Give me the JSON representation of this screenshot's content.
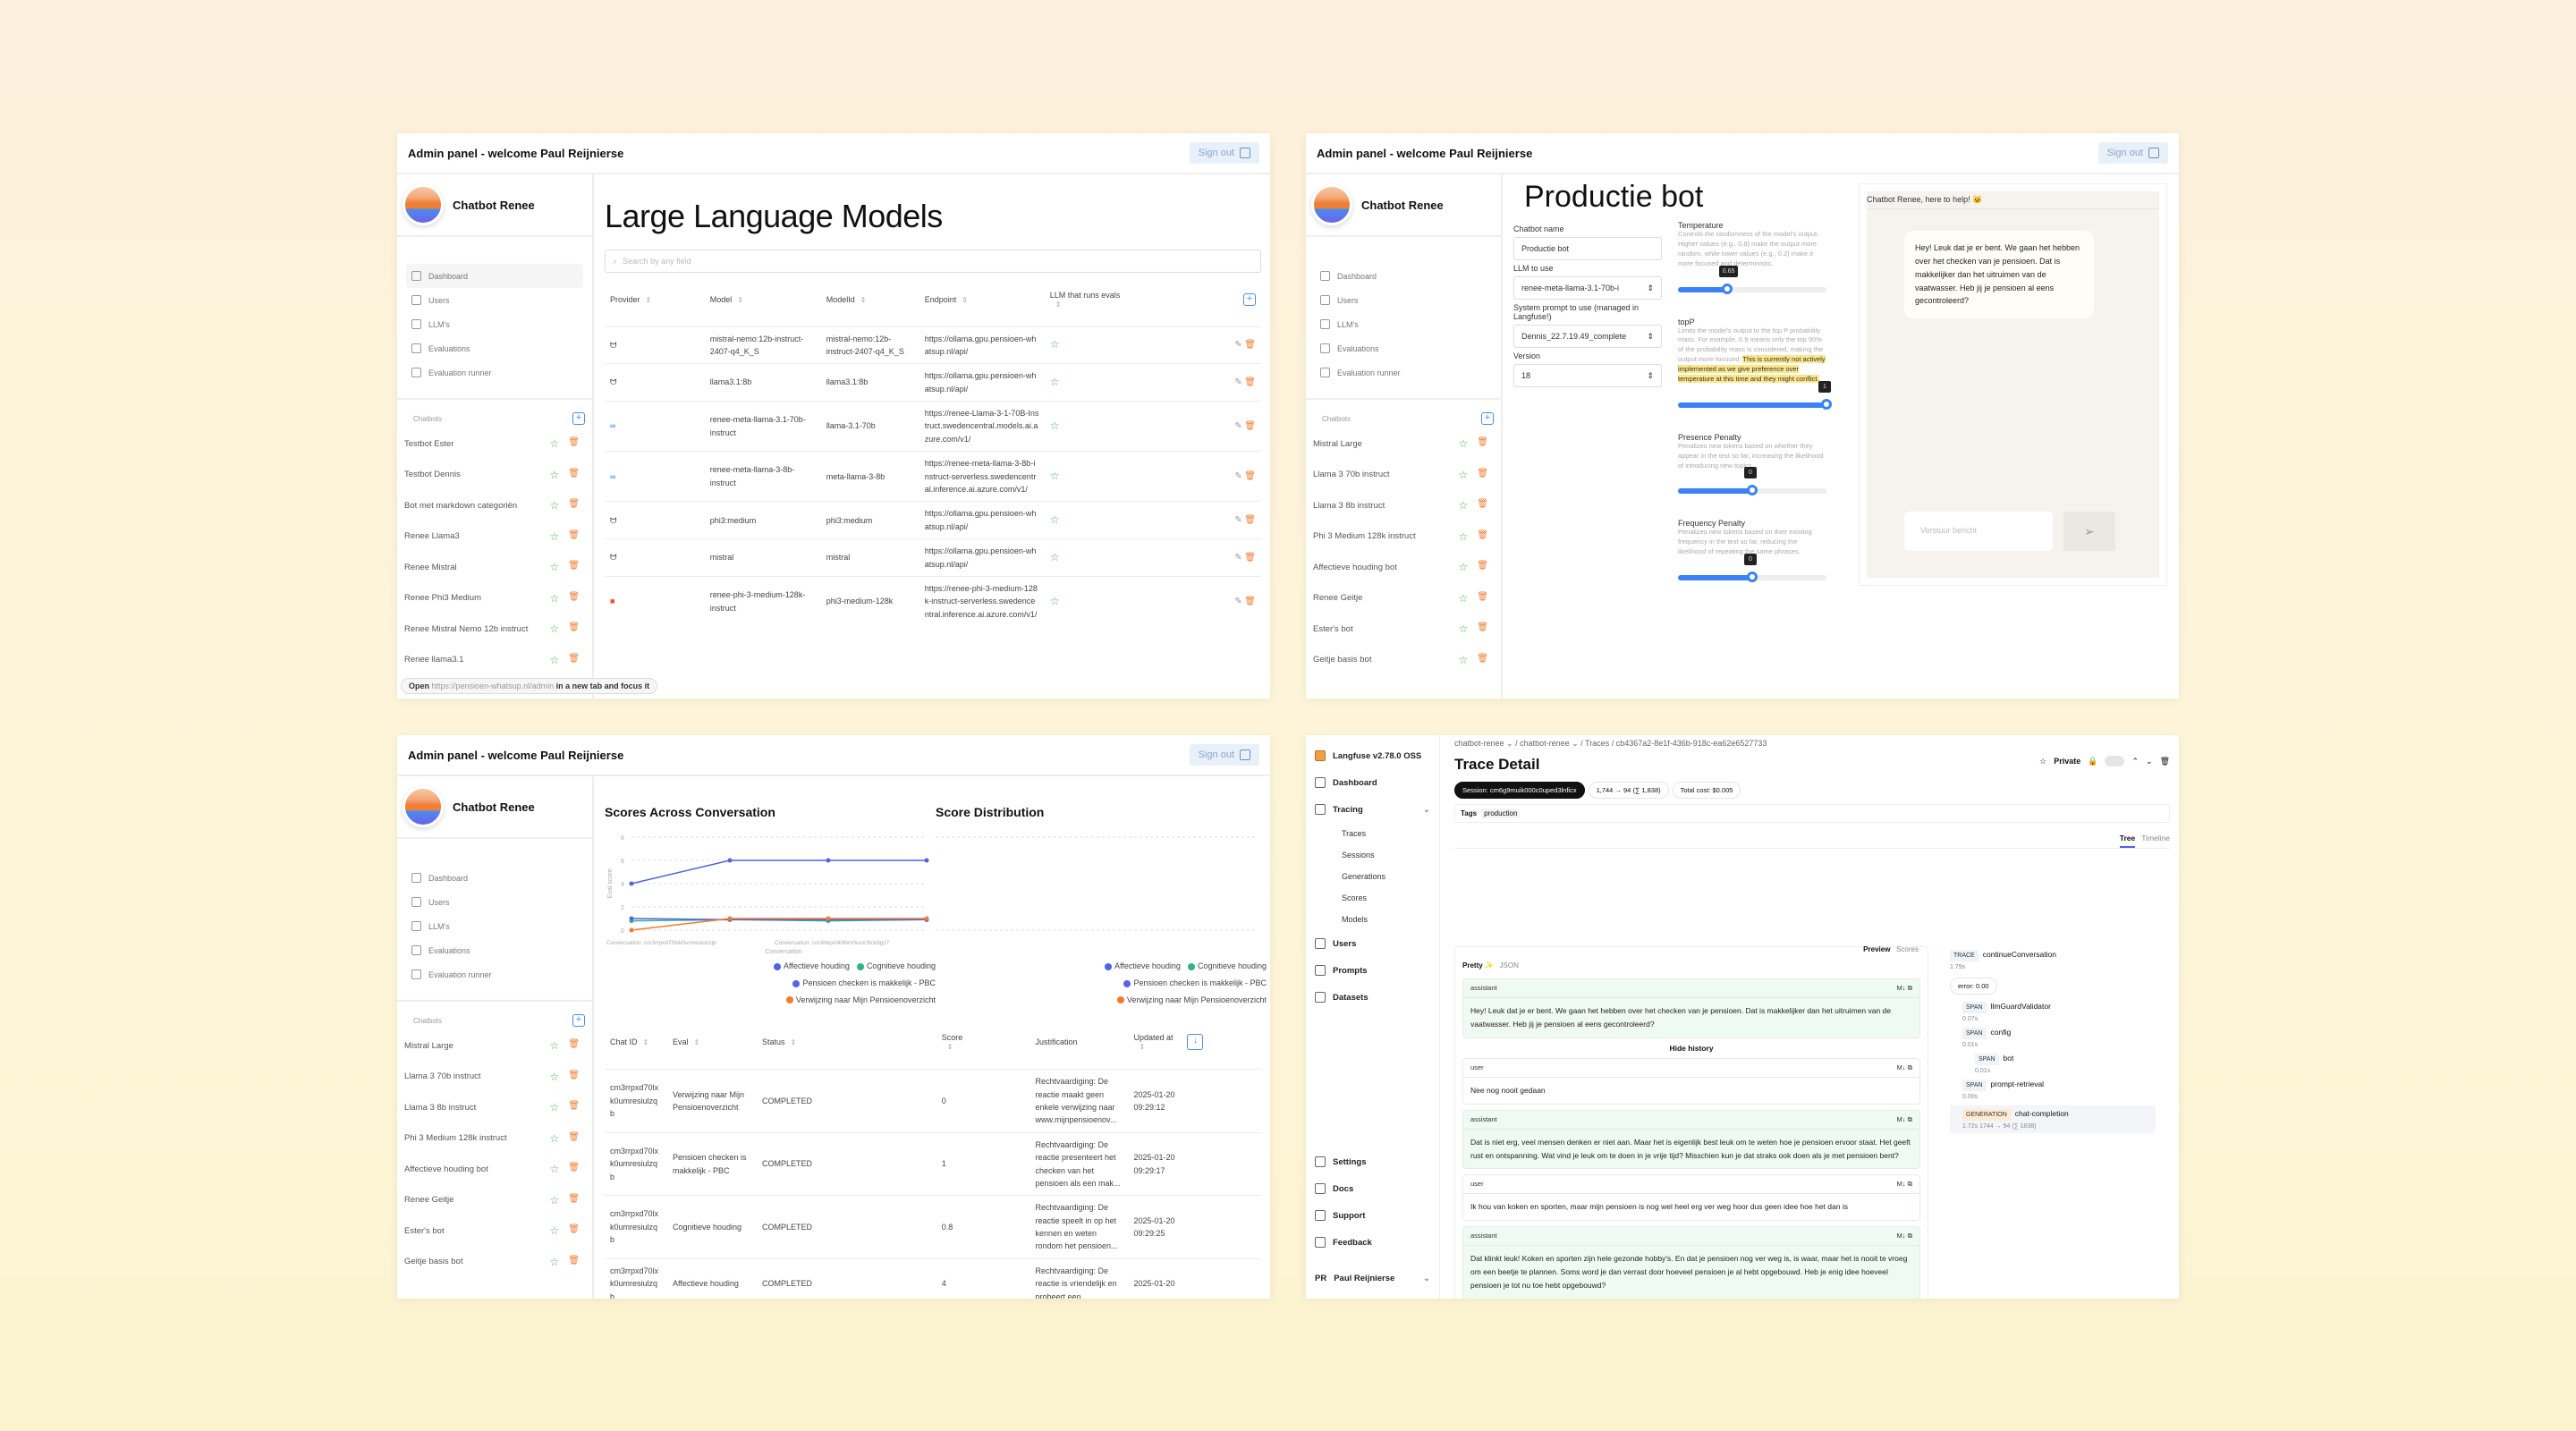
{
  "header": {
    "title": "Admin panel - welcome Paul Reijnierse",
    "signout": "Sign out"
  },
  "brand": {
    "name": "Chatbot Renee"
  },
  "nav": [
    {
      "label": "Dashboard",
      "icon": "dashboard-icon"
    },
    {
      "label": "Users",
      "icon": "users-icon"
    },
    {
      "label": "LLM's",
      "icon": "llm-icon"
    },
    {
      "label": "Evaluations",
      "icon": "evaluations-icon"
    },
    {
      "label": "Evaluation runner",
      "icon": "evaluation-runner-icon"
    }
  ],
  "chatbots_label": "Chatbots",
  "panel1": {
    "title": "Large Language Models",
    "search_placeholder": "Search by any field",
    "chatbots": [
      "Testbot Ester",
      "Testbot Dennis",
      "Bot met markdown categoriën",
      "Renee Llama3",
      "Renee Mistral",
      "Renee Phi3 Medium",
      "Renee Mistral Nemo 12b instruct",
      "Renee llama3.1"
    ],
    "columns": [
      "Provider",
      "Model",
      "ModelId",
      "Endpoint",
      "LLM that runs evals"
    ],
    "rows": [
      {
        "provider": "ollama",
        "model": "mistral-nemo:12b-instruct-2407-q4_K_S",
        "modelId": "mistral-nemo:12b-instruct-2407-q4_K_S",
        "endpoint": "https://ollama.gpu.pensioen-whatsup.nl/api/"
      },
      {
        "provider": "ollama",
        "model": "llama3.1:8b",
        "modelId": "llama3.1:8b",
        "endpoint": "https://ollama.gpu.pensioen-whatsup.nl/api/"
      },
      {
        "provider": "meta",
        "model": "renee-meta-llama-3.1-70b-instruct",
        "modelId": "llama-3.1-70b",
        "endpoint": "https://renee-Llama-3-1-70B-Instruct.swedencentral.models.ai.azure.com/v1/"
      },
      {
        "provider": "meta",
        "model": "renee-meta-llama-3-8b-instruct",
        "modelId": "meta-llama-3-8b",
        "endpoint": "https://renee-meta-llama-3-8b-instruct-serverless.swedencentral.inference.ai.azure.com/v1/"
      },
      {
        "provider": "ollama",
        "model": "phi3:medium",
        "modelId": "phi3:medium",
        "endpoint": "https://ollama.gpu.pensioen-whatsup.nl/api/"
      },
      {
        "provider": "ollama",
        "model": "mistral",
        "modelId": "mistral",
        "endpoint": "https://ollama.gpu.pensioen-whatsup.nl/api/"
      },
      {
        "provider": "microsoft",
        "model": "renee-phi-3-medium-128k-instruct",
        "modelId": "phi3-medium-128k",
        "endpoint": "https://renee-phi-3-medium-128k-instruct-serverless.swedencentral.inference.ai.azure.com/v1/"
      }
    ],
    "tooltip": {
      "open": "Open",
      "url": "https://pensioen-whatsup.nl/admin",
      "rest": "in a new tab and focus it"
    }
  },
  "panel2": {
    "title": "Productie bot",
    "fields": {
      "name_label": "Chatbot name",
      "name_value": "Productie bot",
      "llm_label": "LLM to use",
      "llm_value": "renee-meta-llama-3.1-70b-i",
      "prompt_label": "System prompt to use (managed in Langfuse!)",
      "prompt_value": "Dennis_22.7.19.49_complete",
      "version_label": "Version",
      "version_value": "18"
    },
    "params": [
      {
        "title": "Temperature",
        "desc": "Controls the randomness of the model's output. Higher values (e.g., 0.8) make the output more random, while lower values (e.g., 0.2) make it more focused and deterministic.",
        "highlight": "",
        "value": "0.65",
        "fraction": 0.33
      },
      {
        "title": "topP",
        "desc": "Limits the model's output to the top P probability mass. For example, 0.9 means only the top 90% of the probability mass is considered, making the output more focused.",
        "highlight": "This is currently not actively implemented as we give preference over temperature at this time and they might conflict.",
        "value": "1",
        "fraction": 1.0
      },
      {
        "title": "Presence Penalty",
        "desc": "Penalizes new tokens based on whether they appear in the text so far, increasing the likelihood of introducing new topics.",
        "highlight": "",
        "value": "0",
        "fraction": 0.5
      },
      {
        "title": "Frequency Penalty",
        "desc": "Penalizes new tokens based on their existing frequency in the text so far, reducing the likelihood of repeating the same phrases.",
        "highlight": "",
        "value": "0",
        "fraction": 0.5
      }
    ],
    "chat": {
      "header": "Chatbot Renee, here to help! 🐱",
      "message": "Hey! Leuk dat je er bent. We gaan het hebben over het checken van je pensioen. Dat is makkelijker dan het uitruimen van de vaatwasser. Heb jij je pensioen al eens gecontroleerd?",
      "input_placeholder": "Verstuur bericht"
    },
    "chatbots": [
      "Mistral Large",
      "Llama 3 70b instruct",
      "Llama 3 8b instruct",
      "Phi 3 Medium 128k instruct",
      "Affectieve houding bot",
      "Renee Geitje",
      "Ester's bot",
      "Geitje basis bot"
    ]
  },
  "panel3": {
    "chatbots": [
      "Mistral Large",
      "Llama 3 70b instruct",
      "Llama 3 8b instruct",
      "Phi 3 Medium 128k instruct",
      "Affectieve houding bot",
      "Renee Geitje",
      "Ester's bot",
      "Geitje basis bot"
    ],
    "distribution_title": "Score Distribution",
    "columns": [
      "Chat ID",
      "Eval",
      "Status",
      "Score",
      "Justification",
      "Updated at"
    ],
    "rows": [
      {
        "chat": "cm3rrpxd70lxk0umresiulzqb",
        "eval": "Verwijzing naar Mijn Pensioenoverzicht",
        "status": "COMPLETED",
        "score": "0",
        "just": "Rechtvaardiging: De reactie maakt geen enkele verwijzing naar www.mijnpensioenov...",
        "updated": "2025-01-20 09:29:12"
      },
      {
        "chat": "cm3rrpxd70lxk0umresiulzqb",
        "eval": "Pensioen checken is makkelijk - PBC",
        "status": "COMPLETED",
        "score": "1",
        "just": "Rechtvaardiging: De reactie presenteert het checken van het pensioen als een mak...",
        "updated": "2025-01-20 09:29:17"
      },
      {
        "chat": "cm3rrpxd70lxk0umresiulzqb",
        "eval": "Cognitieve houding",
        "status": "COMPLETED",
        "score": "0.8",
        "just": "Rechtvaardiging: De reactie speelt in op het kennen en weten rondom het pensioen...",
        "updated": "2025-01-20 09:29:25"
      },
      {
        "chat": "cm3rrpxd70lxk0umresiulzqb",
        "eval": "Affectieve houding",
        "status": "COMPLETED",
        "score": "4",
        "just": "Rechtvaardiging: De reactie is vriendelijk en probeert een",
        "updated": "2025-01-20"
      }
    ]
  },
  "chart_data": {
    "type": "line",
    "title": "Scores Across Conversation",
    "xlabel": "Conversation",
    "ylabel": "Eval score",
    "ylim": [
      0,
      8
    ],
    "yticks": [
      0,
      2,
      4,
      6,
      8
    ],
    "x": [
      1,
      2,
      3,
      4
    ],
    "xtick_labels": [
      "Conversation: cm3rrpxd70lxk0umresiulzqb",
      "Conversation: cm3hbpzl40lbm0umr3tck6gz7"
    ],
    "grid": true,
    "legend": "bottom-right",
    "series": [
      {
        "name": "Affectieve houding",
        "color": "#4f63e6",
        "values": [
          4,
          6,
          6,
          6
        ]
      },
      {
        "name": "Cognitieve houding",
        "color": "#2fb38a",
        "values": [
          0.8,
          0.9,
          0.8,
          0.9
        ]
      },
      {
        "name": "Pensioen checken is makkelijk - PBC",
        "color": "#5563e8",
        "values": [
          1,
          0.9,
          0.9,
          0.9
        ]
      },
      {
        "name": "Verwijzing naar Mijn Pensioenoverzicht",
        "color": "#f47b2a",
        "values": [
          0,
          1,
          1,
          1
        ]
      }
    ]
  },
  "panel4": {
    "app": "Langfuse v2.78.0 OSS",
    "nav": [
      "Dashboard",
      "Tracing",
      "Users",
      "Prompts",
      "Datasets"
    ],
    "tracing_sub": [
      "Traces",
      "Sessions",
      "Generations",
      "Scores",
      "Models"
    ],
    "bottom_nav": [
      "Settings",
      "Docs",
      "Support",
      "Feedback"
    ],
    "user": {
      "initials": "PR",
      "name": "Paul Reijnierse"
    },
    "breadcrumb": [
      "chatbot-renee",
      "chatbot-renee",
      "Traces",
      "cb4367a2-8e1f-436b-918c-ea62e6527733"
    ],
    "title": "Trace Detail",
    "private_label": "Private",
    "session": "Session: cm6g9muik000c0uped3lnficx",
    "tokens": "1,744 → 94 (∑ 1,838)",
    "cost": "Total cost: $0.005",
    "tags_label": "Tags",
    "tag": "production",
    "view_tabs": [
      "Tree",
      "Timeline"
    ],
    "io_tabs": [
      "Preview",
      "Scores"
    ],
    "format_tabs": [
      "Pretty ✨",
      "JSON"
    ],
    "hide_history": "Hide history",
    "messages": [
      {
        "role": "assistant",
        "text": "Hey! Leuk dat je er bent. We gaan het hebben over het checken van je pensioen. Dat is makkelijker dan het uitruimen van de vaatwasser. Heb jij je pensioen al eens gecontroleerd?"
      },
      {
        "role": "user",
        "text": "Nee nog nooit gedaan"
      },
      {
        "role": "assistant",
        "text": "Dat is niet erg, veel mensen denken er niet aan. Maar het is eigenlijk best leuk om te weten hoe je pensioen ervoor staat. Het geeft rust en ontspanning. Wat vind je leuk om te doen in je vrije tijd? Misschien kun je dat straks ook doen als je met pensioen bent?"
      },
      {
        "role": "user",
        "text": "Ik hou van koken en sporten, maar mijn pensioen is nog wel heel erg ver weg hoor dus geen idee hoe het dan is"
      },
      {
        "role": "assistant",
        "text": "Dat klinkt leuk! Koken en sporten zijn hele gezonde hobby's. En dat je pensioen nog ver weg is, is waar, maar het is nooit te vroeg om een beetje te plannen. Soms word je dan verrast door hoeveel pensioen je al hebt opgebouwd. Heb je enig idee hoeveel pensioen je tot nu toe hebt opgebouwd?"
      }
    ],
    "tree": [
      {
        "type": "TRACE",
        "name": "continueConversation",
        "dur": "1.79s",
        "level": 0
      },
      {
        "type": "SPAN",
        "name": "llmGuardValidator",
        "dur": "0.07s",
        "level": 1
      },
      {
        "type": "SPAN",
        "name": "config",
        "dur": "0.01s",
        "level": 1
      },
      {
        "type": "SPAN",
        "name": "bot",
        "dur": "0.01s",
        "level": 2
      },
      {
        "type": "SPAN",
        "name": "prompt-retrieval",
        "dur": "0.00s",
        "level": 1
      },
      {
        "type": "GENERATION",
        "name": "chat-completion",
        "dur": "1.72s  1744 → 94 (∑ 1838)",
        "level": 1
      }
    ],
    "error_chip": "error: 0.00"
  }
}
